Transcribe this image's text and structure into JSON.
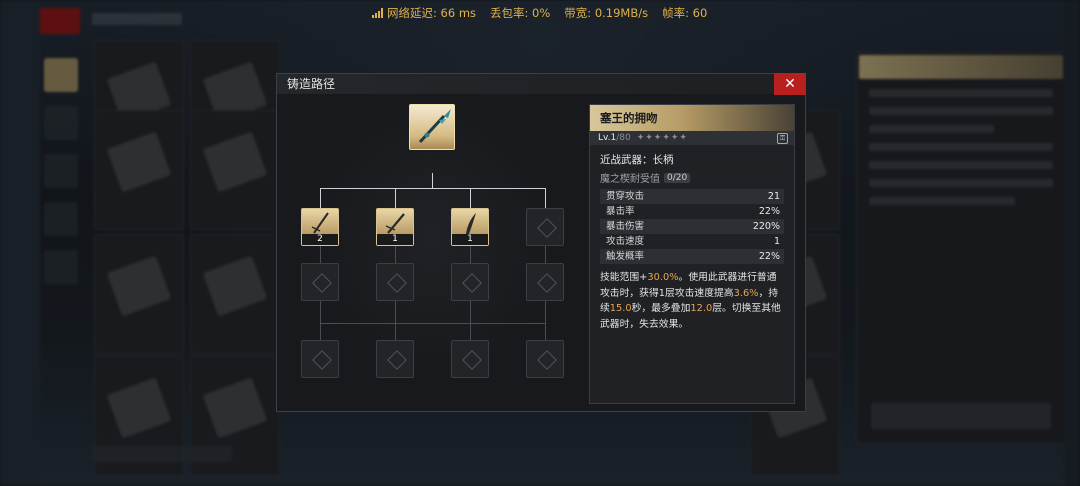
{
  "network": {
    "latency_label": "网络延迟:",
    "latency_value": "66 ms",
    "loss_label": "丢包率:",
    "loss_value": "0%",
    "bandwidth_label": "带宽:",
    "bandwidth_value": "0.19MB/s",
    "fps_label": "帧率:",
    "fps_value": "60"
  },
  "modal": {
    "title": "铸造路径",
    "close_label": "✕"
  },
  "tree": {
    "root_item": "polearm-icon",
    "children": [
      {
        "icon": "sword-icon",
        "count": "2"
      },
      {
        "icon": "sword-icon",
        "count": "1"
      },
      {
        "icon": "blade-icon",
        "count": "1"
      }
    ]
  },
  "item": {
    "name": "塞王的拥吻",
    "level": "Lv.1",
    "level_max": "/80",
    "stars": "✦✦✦✦✦✦",
    "weapon_type": "近战武器：长柄",
    "durability_label": "魔之楔耐受值",
    "durability_value": "0/20",
    "stats": [
      {
        "name": "贯穿攻击",
        "value": "21"
      },
      {
        "name": "暴击率",
        "value": "22%"
      },
      {
        "name": "暴击伤害",
        "value": "220%"
      },
      {
        "name": "攻击速度",
        "value": "1"
      },
      {
        "name": "触发概率",
        "value": "22%"
      }
    ],
    "desc": {
      "p1": "技能范围+",
      "v1": "30.0%",
      "p2": "。使用此武器进行普通攻击时，获得1层攻击速度提高",
      "v2": "3.6%",
      "p3": "，持续",
      "v3": "15.0",
      "p4": "秒，最多叠加",
      "v4": "12.0",
      "p5": "层。切换至其他武器时，失去效果。"
    }
  },
  "colors": {
    "accent_gold": "#d8c79a",
    "highlight_orange": "#e8a64c",
    "close_red": "#b8201f",
    "netbar_yellow": "#e0b24a"
  }
}
